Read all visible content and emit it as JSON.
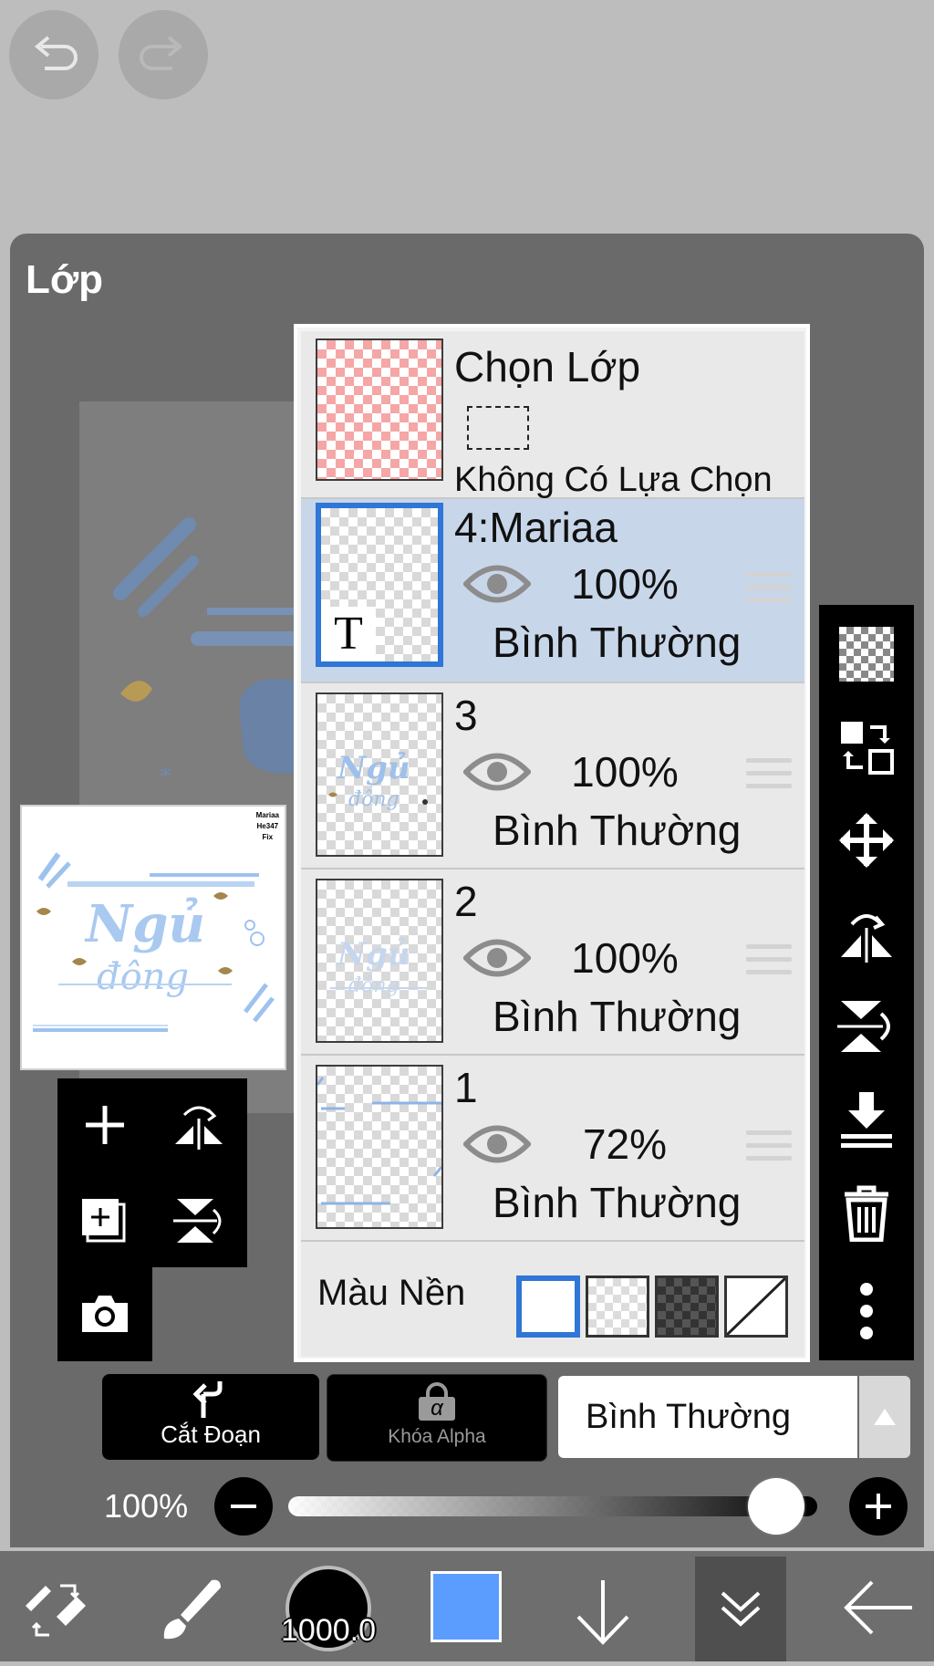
{
  "app": {
    "panel_title": "Lớp"
  },
  "layers_panel": {
    "selection_layer": {
      "title": "Chọn Lớp",
      "status": "Không Có Lựa Chọn"
    },
    "layers": [
      {
        "name": "4:Mariaa",
        "opacity": "100%",
        "blend": "Bình Thường",
        "type": "text",
        "selected": true,
        "thumb_text": "T"
      },
      {
        "name": "3",
        "opacity": "100%",
        "blend": "Bình Thường",
        "selected": false
      },
      {
        "name": "2",
        "opacity": "100%",
        "blend": "Bình Thường",
        "selected": false
      },
      {
        "name": "1",
        "opacity": "72%",
        "blend": "Bình Thường",
        "selected": false
      }
    ],
    "background": {
      "label": "Màu Nền",
      "options": [
        "white",
        "light-checker",
        "dark-checker",
        "none"
      ],
      "selected": "white"
    }
  },
  "preview": {
    "stamp_text": "Mariaa\nHe347\nFix"
  },
  "controls": {
    "clipping_label": "Cắt Đoạn",
    "alpha_lock_label": "Khóa Alpha",
    "alpha_lock_glyph": "α",
    "blend_mode_value": "Bình Thường",
    "opacity_label": "100%",
    "opacity_value": 1.0
  },
  "toolbar": {
    "brush_size": "1000.0",
    "color": "#5b9cff"
  },
  "colors": {
    "accent": "#2f76d6",
    "selected_row": "#c8d6ea",
    "panel": "#6a6a6a"
  }
}
